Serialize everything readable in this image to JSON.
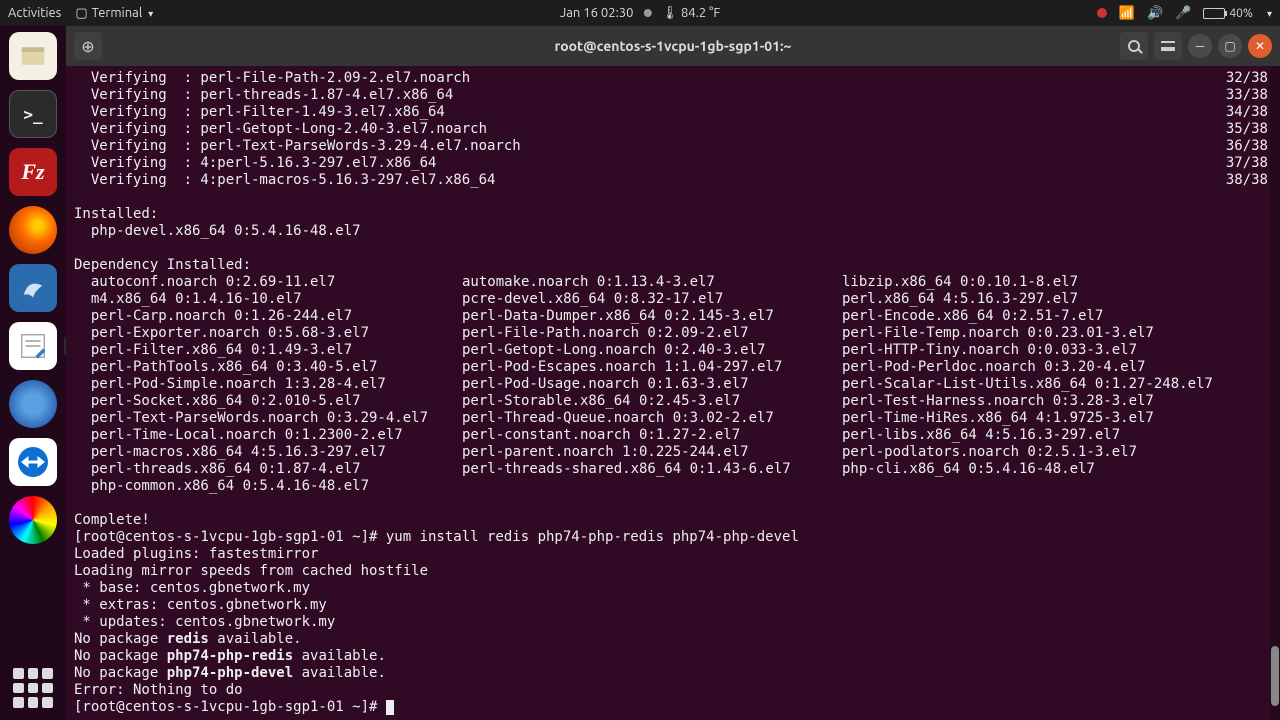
{
  "topbar": {
    "activities": "Activities",
    "app_menu": "Terminal",
    "date": "Jan 16  02:30",
    "temp": "84.2 °F",
    "battery": "40%"
  },
  "dock": {
    "tooltip": "Text Editor"
  },
  "window": {
    "title": "root@centos-s-1vcpu-1gb-sgp1-01:~"
  },
  "term": {
    "verifying_label": "  Verifying  :",
    "verifying": [
      {
        "pkg": "perl-File-Path-2.09-2.el7.noarch",
        "n": "32/38"
      },
      {
        "pkg": "perl-threads-1.87-4.el7.x86_64",
        "n": "33/38"
      },
      {
        "pkg": "perl-Filter-1.49-3.el7.x86_64",
        "n": "34/38"
      },
      {
        "pkg": "perl-Getopt-Long-2.40-3.el7.noarch",
        "n": "35/38"
      },
      {
        "pkg": "perl-Text-ParseWords-3.29-4.el7.noarch",
        "n": "36/38"
      },
      {
        "pkg": "4:perl-5.16.3-297.el7.x86_64",
        "n": "37/38"
      },
      {
        "pkg": "4:perl-macros-5.16.3-297.el7.x86_64",
        "n": "38/38"
      }
    ],
    "installed_hdr": "Installed:",
    "installed_pkg": "  php-devel.x86_64 0:5.4.16-48.el7",
    "dep_hdr": "Dependency Installed:",
    "deps": [
      [
        "autoconf.noarch 0:2.69-11.el7",
        "automake.noarch 0:1.13.4-3.el7",
        "libzip.x86_64 0:0.10.1-8.el7"
      ],
      [
        "m4.x86_64 0:1.4.16-10.el7",
        "pcre-devel.x86_64 0:8.32-17.el7",
        "perl.x86_64 4:5.16.3-297.el7"
      ],
      [
        "perl-Carp.noarch 0:1.26-244.el7",
        "perl-Data-Dumper.x86_64 0:2.145-3.el7",
        "perl-Encode.x86_64 0:2.51-7.el7"
      ],
      [
        "perl-Exporter.noarch 0:5.68-3.el7",
        "perl-File-Path.noarch 0:2.09-2.el7",
        "perl-File-Temp.noarch 0:0.23.01-3.el7"
      ],
      [
        "perl-Filter.x86_64 0:1.49-3.el7",
        "perl-Getopt-Long.noarch 0:2.40-3.el7",
        "perl-HTTP-Tiny.noarch 0:0.033-3.el7"
      ],
      [
        "perl-PathTools.x86_64 0:3.40-5.el7",
        "perl-Pod-Escapes.noarch 1:1.04-297.el7",
        "perl-Pod-Perldoc.noarch 0:3.20-4.el7"
      ],
      [
        "perl-Pod-Simple.noarch 1:3.28-4.el7",
        "perl-Pod-Usage.noarch 0:1.63-3.el7",
        "perl-Scalar-List-Utils.x86_64 0:1.27-248.el7"
      ],
      [
        "perl-Socket.x86_64 0:2.010-5.el7",
        "perl-Storable.x86_64 0:2.45-3.el7",
        "perl-Test-Harness.noarch 0:3.28-3.el7"
      ],
      [
        "perl-Text-ParseWords.noarch 0:3.29-4.el7",
        "perl-Thread-Queue.noarch 0:3.02-2.el7",
        "perl-Time-HiRes.x86_64 4:1.9725-3.el7"
      ],
      [
        "perl-Time-Local.noarch 0:1.2300-2.el7",
        "perl-constant.noarch 0:1.27-2.el7",
        "perl-libs.x86_64 4:5.16.3-297.el7"
      ],
      [
        "perl-macros.x86_64 4:5.16.3-297.el7",
        "perl-parent.noarch 1:0.225-244.el7",
        "perl-podlators.noarch 0:2.5.1-3.el7"
      ],
      [
        "perl-threads.x86_64 0:1.87-4.el7",
        "perl-threads-shared.x86_64 0:1.43-6.el7",
        "php-cli.x86_64 0:5.4.16-48.el7"
      ],
      [
        "php-common.x86_64 0:5.4.16-48.el7",
        "",
        ""
      ]
    ],
    "complete": "Complete!",
    "prompt1": "[root@centos-s-1vcpu-1gb-sgp1-01 ~]# ",
    "cmd": "yum install redis php74-php-redis php74-php-devel",
    "out": [
      "Loaded plugins: fastestmirror",
      "Loading mirror speeds from cached hostfile",
      " * base: centos.gbnetwork.my",
      " * extras: centos.gbnetwork.my",
      " * updates: centos.gbnetwork.my"
    ],
    "nopkg_prefix": "No package ",
    "nopkg_suffix": " available.",
    "nopkg": [
      "redis",
      "php74-php-redis",
      "php74-php-devel"
    ],
    "error": "Error: Nothing to do",
    "prompt2": "[root@centos-s-1vcpu-1gb-sgp1-01 ~]# "
  }
}
